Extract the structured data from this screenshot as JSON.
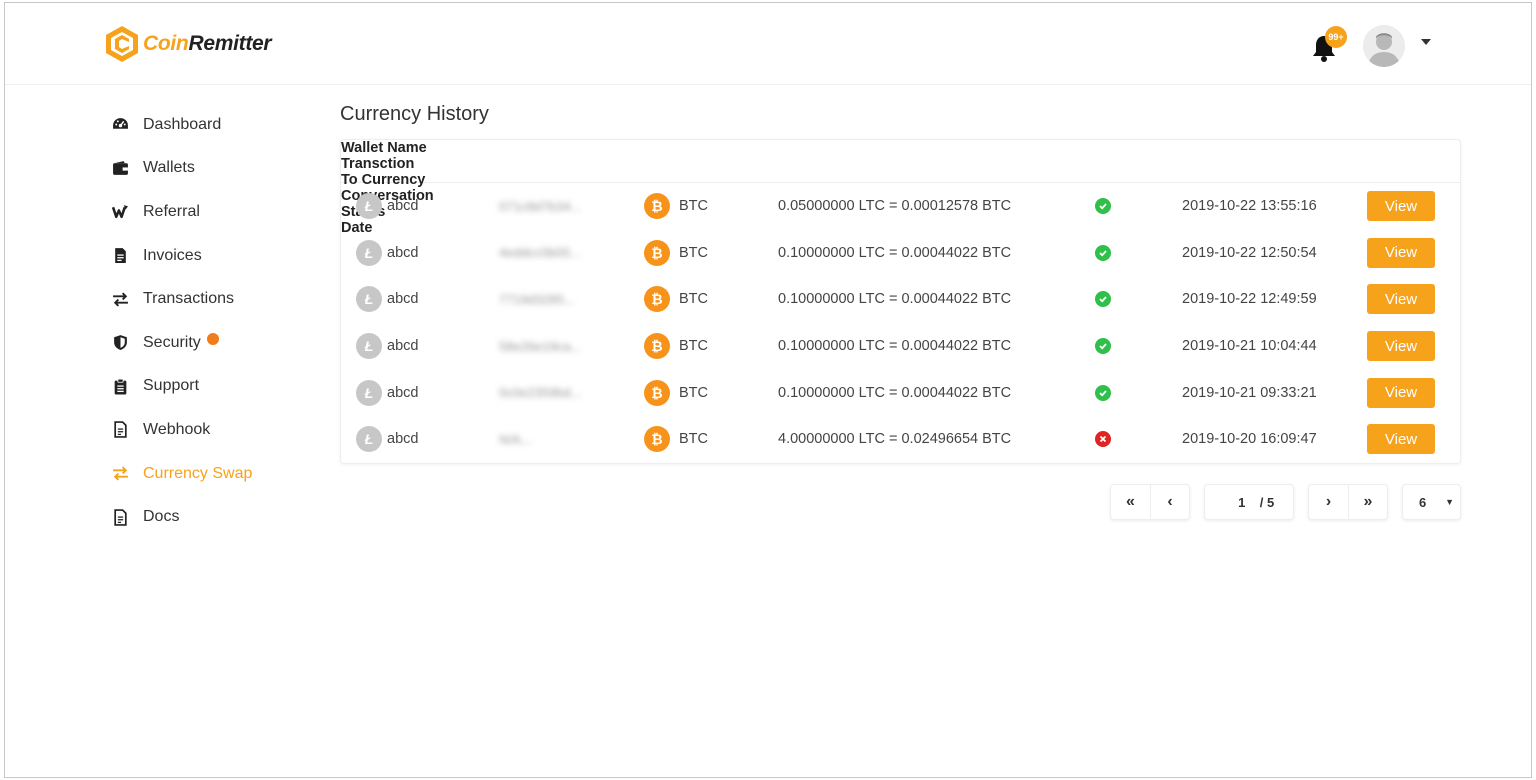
{
  "header": {
    "logo_coin": "Coin",
    "logo_remitter": "Remitter",
    "notification_badge": "99+"
  },
  "sidebar": {
    "items": [
      {
        "label": "Dashboard",
        "icon": "dashboard-icon"
      },
      {
        "label": "Wallets",
        "icon": "wallet-icon"
      },
      {
        "label": "Referral",
        "icon": "referral-icon"
      },
      {
        "label": "Invoices",
        "icon": "invoice-icon"
      },
      {
        "label": "Transactions",
        "icon": "transactions-icon"
      },
      {
        "label": "Security",
        "icon": "shield-icon"
      },
      {
        "label": "Support",
        "icon": "clipboard-icon"
      },
      {
        "label": "Webhook",
        "icon": "document-icon"
      },
      {
        "label": "Currency Swap",
        "icon": "swap-icon",
        "active": true
      },
      {
        "label": "Docs",
        "icon": "document-icon"
      }
    ]
  },
  "main": {
    "title": "Currency History",
    "columns": [
      "Wallet Name",
      "Transction",
      "To Currency",
      "Conversation",
      "Status",
      "Date"
    ],
    "rows": [
      {
        "wallet": "abcd",
        "txn": "071c8d7b34...",
        "to": "BTC",
        "conv": "0.05000000 LTC = 0.00012578 BTC",
        "status": "success",
        "date": "2019-10-22 13:55:16",
        "action": "View"
      },
      {
        "wallet": "abcd",
        "txn": "4eddcc0b00...",
        "to": "BTC",
        "conv": "0.10000000 LTC = 0.00044022 BTC",
        "status": "success",
        "date": "2019-10-22 12:50:54",
        "action": "View"
      },
      {
        "wallet": "abcd",
        "txn": "7719d3285...",
        "to": "BTC",
        "conv": "0.10000000 LTC = 0.00044022 BTC",
        "status": "success",
        "date": "2019-10-22 12:49:59",
        "action": "View"
      },
      {
        "wallet": "abcd",
        "txn": "58e26e19ca...",
        "to": "BTC",
        "conv": "0.10000000 LTC = 0.00044022 BTC",
        "status": "success",
        "date": "2019-10-21 10:04:44",
        "action": "View"
      },
      {
        "wallet": "abcd",
        "txn": "0c0e2359bd...",
        "to": "BTC",
        "conv": "0.10000000 LTC = 0.00044022 BTC",
        "status": "success",
        "date": "2019-10-21 09:33:21",
        "action": "View"
      },
      {
        "wallet": "abcd",
        "txn": "N/A...",
        "to": "BTC",
        "conv": "4.00000000 LTC = 0.02496654 BTC",
        "status": "failed",
        "date": "2019-10-20 16:09:47",
        "action": "View"
      }
    ]
  },
  "pagination": {
    "first": "«",
    "prev": "‹",
    "current": "1",
    "total": "/ 5",
    "next": "›",
    "last": "»",
    "per_page": "6"
  },
  "colors": {
    "accent": "#f7a21b",
    "btc": "#f7931a",
    "ltc": "#c7c7c7",
    "success": "#2fbf4a",
    "error": "#e02424",
    "alert_dot": "#f07d1a"
  }
}
